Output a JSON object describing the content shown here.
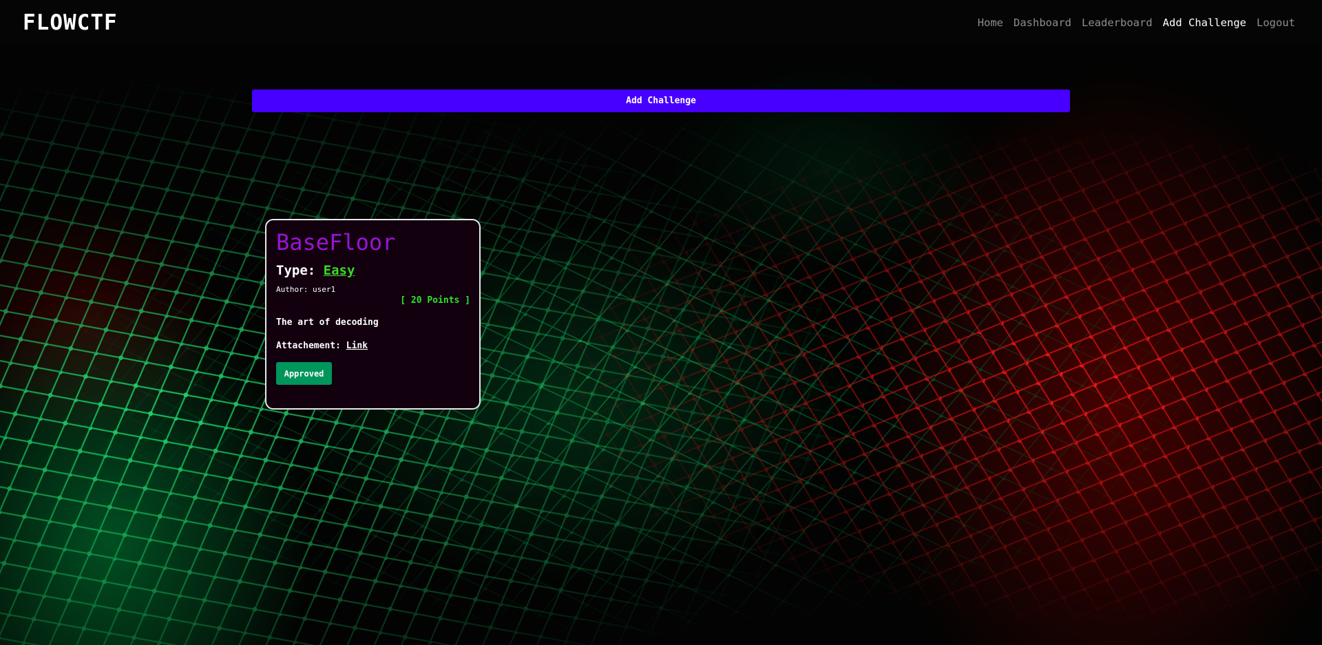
{
  "navbar": {
    "brand": "FLOWCTF",
    "links": [
      {
        "label": "Home",
        "active": false
      },
      {
        "label": "Dashboard",
        "active": false
      },
      {
        "label": "Leaderboard",
        "active": false
      },
      {
        "label": "Add Challenge",
        "active": true
      },
      {
        "label": "Logout",
        "active": false
      }
    ]
  },
  "main": {
    "add_challenge_label": "Add Challenge"
  },
  "challenge": {
    "title": "BaseFloor",
    "type_label": "Type:",
    "type_value": "Easy",
    "author": "Author: user1",
    "points": "[ 20 Points ]",
    "description": "The art of decoding",
    "attachment_label": "Attachement:",
    "attachment_link": "Link",
    "status": "Approved"
  },
  "colors": {
    "accent": "#4700ff",
    "title": "#9a14d4",
    "type": "#38d926",
    "points": "#2ee52a",
    "status": "#00955a"
  }
}
